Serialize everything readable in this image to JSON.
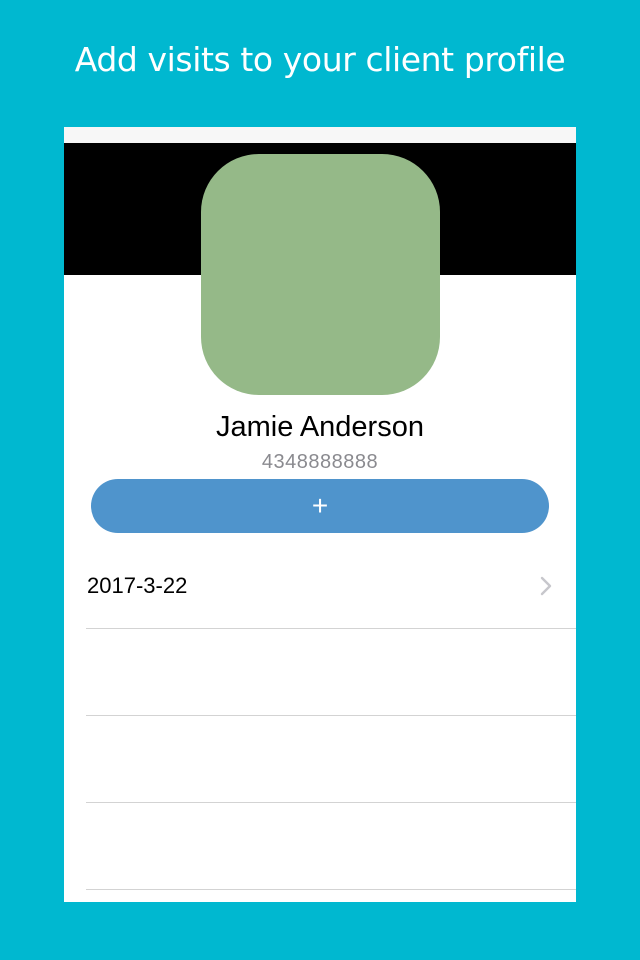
{
  "headline": "Add visits to your client profile",
  "colors": {
    "background": "#00b8d0",
    "cover": "#000000",
    "avatar": "#95b988",
    "add_button": "#4f94cc",
    "phone_text": "#8a8a8f",
    "separator": "#d3d3d3"
  },
  "profile": {
    "name": "Jamie Anderson",
    "phone": "4348888888",
    "avatar_icon": "avatar-placeholder"
  },
  "add_button": {
    "label": "+"
  },
  "visits": [
    {
      "date": "2017-3-22",
      "icon": "chevron-right-icon"
    },
    {
      "date": ""
    },
    {
      "date": ""
    },
    {
      "date": ""
    }
  ]
}
